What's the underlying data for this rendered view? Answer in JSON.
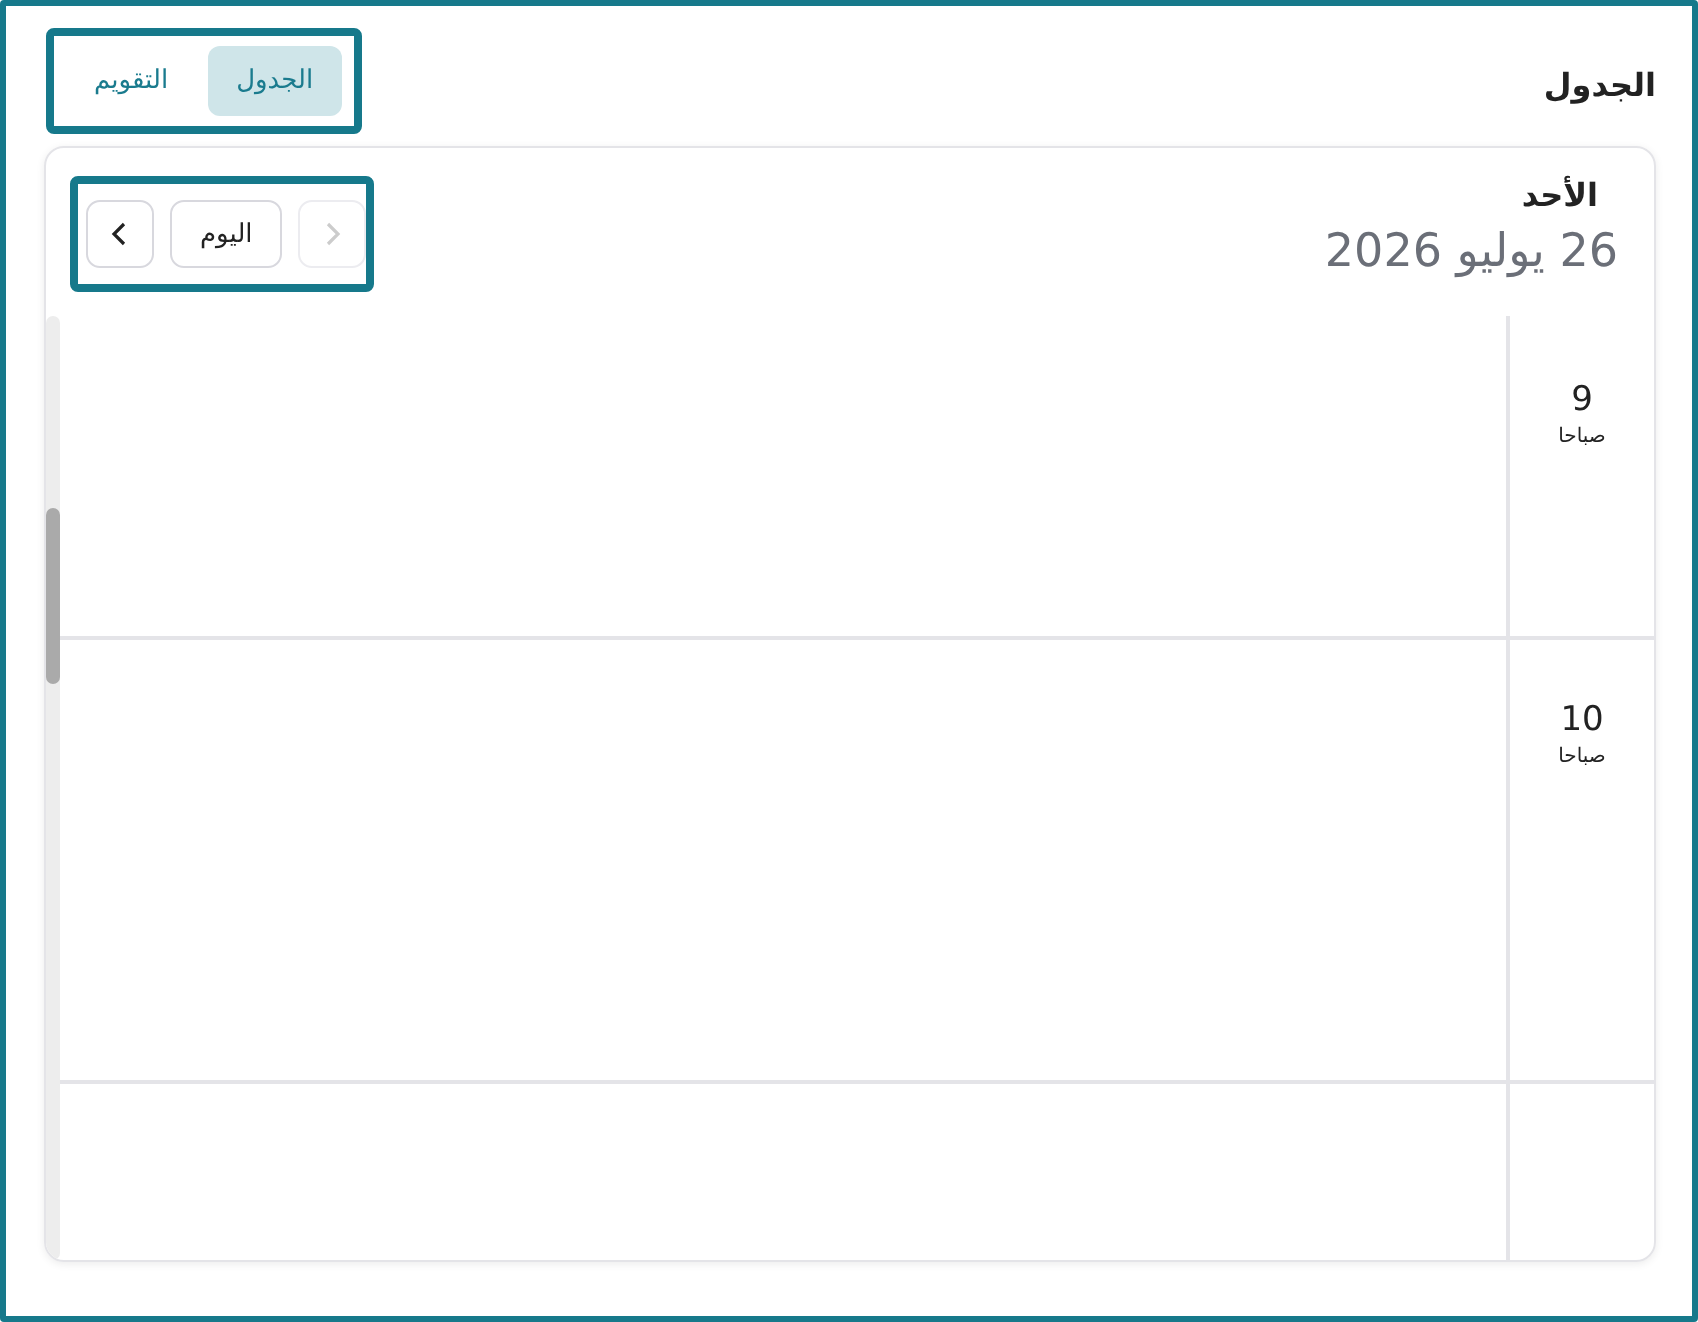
{
  "title": "الجدول",
  "tabs": [
    {
      "label": "الجدول",
      "selected": true
    },
    {
      "label": "التقويم",
      "selected": false
    }
  ],
  "day": {
    "name": "الأحد",
    "date": "26 يوليو 2026"
  },
  "nav": [
    {
      "kind": "prev",
      "disabled": true
    },
    {
      "kind": "today",
      "label": "اليوم",
      "disabled": false
    },
    {
      "kind": "next",
      "disabled": false
    }
  ],
  "hours": [
    {
      "hour": "9",
      "period": "صباحا"
    },
    {
      "hour": "10",
      "period": "صباحا"
    }
  ]
}
